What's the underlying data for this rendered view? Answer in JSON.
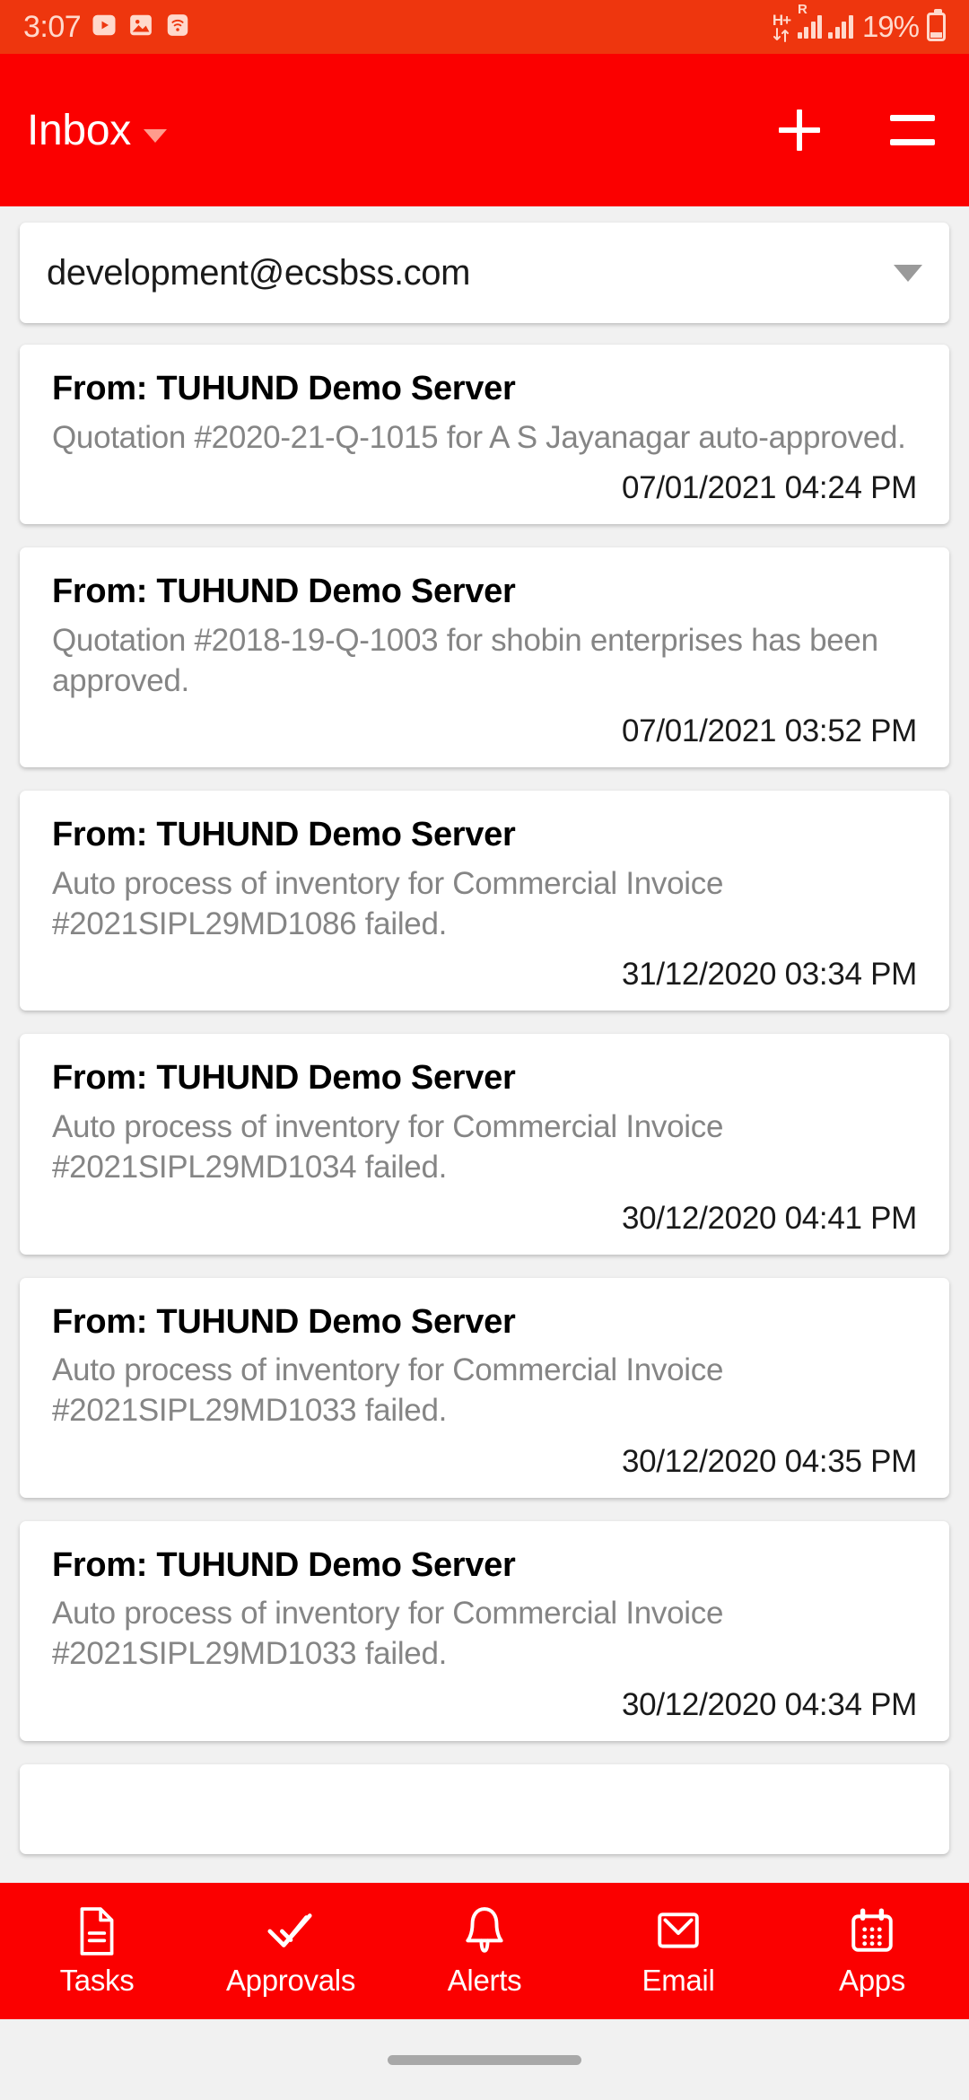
{
  "status_bar": {
    "time": "3:07",
    "icons_left": [
      "youtube-icon",
      "image-icon",
      "wifi-icon"
    ],
    "network_type": "H+",
    "roaming": "R",
    "battery_percent": "19%",
    "background_color": "#ee360e",
    "foreground_color": "#ffd9cc"
  },
  "app_bar": {
    "title": "Inbox",
    "dropdown_icon": "caret-down-icon",
    "add_icon": "plus-icon",
    "menu_icon": "hamburger-menu-icon",
    "background_color": "#fb0000"
  },
  "account": {
    "email": "development@ecsbss.com",
    "dropdown_icon": "caret-down-icon"
  },
  "mails": [
    {
      "from": "From: TUHUND Demo Server",
      "body": "Quotation #2020-21-Q-1015 for A S Jayanagar auto-approved.",
      "time": "07/01/2021 04:24 PM"
    },
    {
      "from": "From: TUHUND Demo Server",
      "body": "Quotation #2018-19-Q-1003 for shobin enterprises has been approved.",
      "time": "07/01/2021 03:52 PM"
    },
    {
      "from": "From: TUHUND Demo Server",
      "body": "Auto process of inventory for Commercial Invoice #2021SIPL29MD1086 failed.",
      "time": "31/12/2020 03:34 PM"
    },
    {
      "from": "From: TUHUND Demo Server",
      "body": "Auto process of inventory for Commercial Invoice #2021SIPL29MD1034 failed.",
      "time": "30/12/2020 04:41 PM"
    },
    {
      "from": "From: TUHUND Demo Server",
      "body": "Auto process of inventory for Commercial Invoice #2021SIPL29MD1033 failed.",
      "time": "30/12/2020 04:35 PM"
    },
    {
      "from": "From: TUHUND Demo Server",
      "body": "Auto process of inventory for Commercial Invoice #2021SIPL29MD1033 failed.",
      "time": "30/12/2020 04:34 PM"
    }
  ],
  "bottom_nav": {
    "items": [
      {
        "label": "Tasks",
        "icon": "document-icon"
      },
      {
        "label": "Approvals",
        "icon": "double-check-icon"
      },
      {
        "label": "Alerts",
        "icon": "bell-icon"
      },
      {
        "label": "Email",
        "icon": "envelope-icon"
      },
      {
        "label": "Apps",
        "icon": "calendar-grid-icon"
      }
    ],
    "background_color": "#fb0000"
  }
}
